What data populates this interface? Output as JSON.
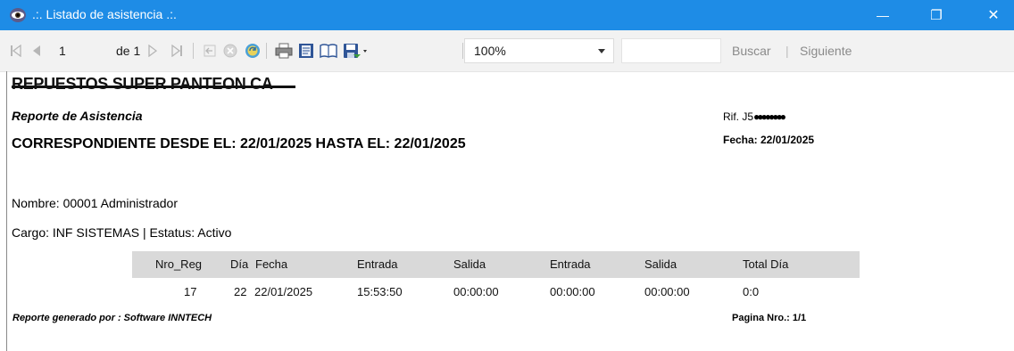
{
  "window": {
    "title": ".:. Listado de asistencia .:.",
    "minimize_glyph": "—",
    "restore_glyph": "❐",
    "close_glyph": "✕"
  },
  "toolbar": {
    "page_current": "1",
    "page_of": "de 1",
    "zoom_value": "100%",
    "search_value": "",
    "search_label": "Buscar",
    "search_separator": "|",
    "next_label": "Siguiente",
    "icons": [
      "first-page-icon",
      "prev-page-icon",
      "next-page-icon",
      "last-page-icon",
      "back-icon",
      "stop-icon",
      "refresh-icon",
      "print-icon",
      "print-layout-icon",
      "page-setup-icon",
      "export-icon"
    ]
  },
  "report": {
    "company": "REPUESTOS SUPER PANTEON CA",
    "report_title": "Reporte de Asistencia",
    "range_text": "CORRESPONDIENTE DESDE EL: 22/01/2025 HASTA EL: 22/01/2025",
    "rif_label": "Rif. J5",
    "rif_redacted": "●●●●●●●●",
    "fecha": "Fecha: 22/01/2025",
    "nombre": "Nombre: 00001 Administrador",
    "cargo": "Cargo: INF SISTEMAS | Estatus: Activo",
    "columns": [
      "Nro_Reg",
      "Día",
      "Fecha",
      "Entrada",
      "Salida",
      "Entrada",
      "Salida",
      "Total Día"
    ],
    "rows": [
      [
        "17",
        "22",
        "22/01/2025",
        "15:53:50",
        "00:00:00",
        "00:00:00",
        "00:00:00",
        "0:0"
      ]
    ],
    "footer_left": "Reporte generado por : Software INNTECH",
    "footer_right": "Pagina Nro.: 1/1"
  }
}
